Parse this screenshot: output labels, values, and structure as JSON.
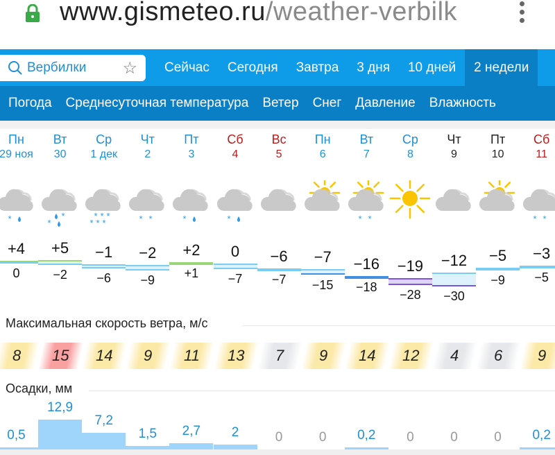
{
  "browser": {
    "url_host": "www.gismeteo.ru",
    "url_path": "/weather-verbilk",
    "lock_color": "#3aa948"
  },
  "search": {
    "value": "Вербилки"
  },
  "tabs": [
    {
      "label": "Сейчас"
    },
    {
      "label": "Сегодня"
    },
    {
      "label": "Завтра"
    },
    {
      "label": "3 дня"
    },
    {
      "label": "10 дней"
    },
    {
      "label": "2 недели",
      "active": true
    }
  ],
  "subnav": [
    {
      "label": "Погода"
    },
    {
      "label": "Среднесуточная температура"
    },
    {
      "label": "Ветер"
    },
    {
      "label": "Снег"
    },
    {
      "label": "Давление"
    },
    {
      "label": "Влажность"
    }
  ],
  "wind_title": "Максимальная скорость ветра, м/с",
  "precip_title": "Осадки, мм",
  "days": [
    {
      "dow": "Пн",
      "date": "29 ноя",
      "color": "blue",
      "icon": "cloud-snow-rain",
      "precip_icon": "snow-rain",
      "tmax": "+4",
      "tmin": "0",
      "max": 4,
      "min": 0,
      "wind": "8",
      "wind_level": "yellow",
      "precip": "0,5",
      "p": 0.5
    },
    {
      "dow": "Вт",
      "date": "30",
      "color": "blue",
      "icon": "cloud-snow-rain",
      "precip_icon": "snow-rain-heavy",
      "tmax": "+5",
      "tmin": "−2",
      "max": 5,
      "min": -2,
      "wind": "15",
      "wind_level": "red",
      "precip": "12,9",
      "p": 12.9
    },
    {
      "dow": "Ср",
      "date": "1 дек",
      "color": "blue",
      "icon": "cloud-snow",
      "precip_icon": "snow-heavy",
      "tmax": "−1",
      "tmin": "−6",
      "max": -1,
      "min": -6,
      "wind": "14",
      "wind_level": "yellow",
      "precip": "7,2",
      "p": 7.2
    },
    {
      "dow": "Чт",
      "date": "2",
      "color": "blue",
      "icon": "cloud-snow",
      "precip_icon": "snow",
      "tmax": "−2",
      "tmin": "−9",
      "max": -2,
      "min": -9,
      "wind": "9",
      "wind_level": "yellow",
      "precip": "1,5",
      "p": 1.5
    },
    {
      "dow": "Пт",
      "date": "3",
      "color": "blue",
      "icon": "cloud-snow-rain",
      "precip_icon": "snow-rain",
      "tmax": "+2",
      "tmin": "+1",
      "max": 2,
      "min": 1,
      "wind": "11",
      "wind_level": "yellow",
      "precip": "2,7",
      "p": 2.7
    },
    {
      "dow": "Сб",
      "date": "4",
      "color": "red",
      "icon": "cloud-snow-rain",
      "precip_icon": "snow-rain",
      "tmax": "0",
      "tmin": "−7",
      "max": 0,
      "min": -7,
      "wind": "13",
      "wind_level": "yellow",
      "precip": "2",
      "p": 2
    },
    {
      "dow": "Вс",
      "date": "5",
      "color": "red",
      "icon": "cloud",
      "precip_icon": "",
      "tmax": "−6",
      "tmin": "−7",
      "max": -6,
      "min": -7,
      "wind": "7",
      "wind_level": "gray",
      "precip": "0",
      "p": 0
    },
    {
      "dow": "Пн",
      "date": "6",
      "color": "blue",
      "icon": "sun-cloud",
      "precip_icon": "",
      "tmax": "−7",
      "tmin": "−15",
      "max": -7,
      "min": -15,
      "wind": "9",
      "wind_level": "yellow",
      "precip": "0",
      "p": 0
    },
    {
      "dow": "Вт",
      "date": "7",
      "color": "blue",
      "icon": "sun-cloud-snow",
      "precip_icon": "snow",
      "tmax": "−16",
      "tmin": "−18",
      "max": -16,
      "min": -18,
      "wind": "14",
      "wind_level": "yellow",
      "precip": "0,2",
      "p": 0.2
    },
    {
      "dow": "Ср",
      "date": "8",
      "color": "blue",
      "icon": "sun",
      "precip_icon": "",
      "tmax": "−19",
      "tmin": "−28",
      "max": -19,
      "min": -28,
      "wind": "12",
      "wind_level": "yellow",
      "precip": "0",
      "p": 0
    },
    {
      "dow": "Чт",
      "date": "9",
      "color": "black",
      "icon": "cloud",
      "precip_icon": "",
      "tmax": "−12",
      "tmin": "−30",
      "max": -12,
      "min": -30,
      "wind": "4",
      "wind_level": "gray",
      "precip": "0",
      "p": 0
    },
    {
      "dow": "Пт",
      "date": "10",
      "color": "black",
      "icon": "sun-cloud",
      "precip_icon": "",
      "tmax": "−5",
      "tmin": "−9",
      "max": -5,
      "min": -9,
      "wind": "6",
      "wind_level": "gray",
      "precip": "0",
      "p": 0
    },
    {
      "dow": "Сб",
      "date": "11",
      "color": "red",
      "icon": "cloud-snow",
      "precip_icon": "snow",
      "tmax": "−3",
      "tmin": "−5",
      "max": -3,
      "min": -5,
      "wind": "9",
      "wind_level": "yellow",
      "precip": "0,2",
      "p": 0.2
    }
  ],
  "colors": {
    "warm": "#9bd67a",
    "cold": "#79cdf3",
    "colder": "#3f8ee0",
    "coldest": "#7b55d8",
    "wind_yellow": "#fbe9a8",
    "wind_red": "#f9a0a0",
    "wind_gray": "#e6e7ea",
    "precip_bar": "#9fd4fb",
    "precip_text": "#1f8fd8",
    "zero_text": "#999999"
  }
}
